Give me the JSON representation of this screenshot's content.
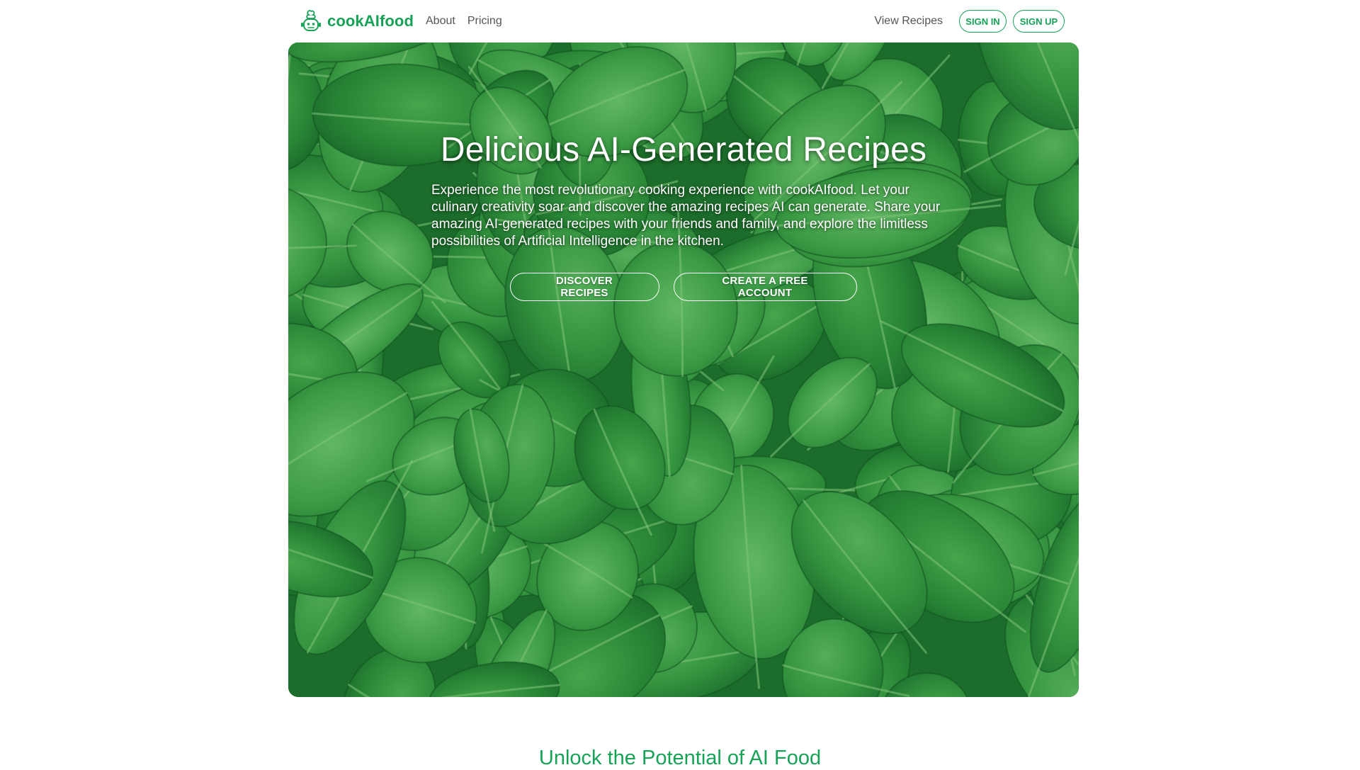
{
  "brand": {
    "name": "cookAIfood",
    "icon": "chef-robot-icon",
    "color": "#17a257"
  },
  "nav": {
    "about": "About",
    "pricing": "Pricing",
    "view_recipes": "View Recipes",
    "sign_in": "SIGN IN",
    "sign_up": "SIGN UP"
  },
  "hero": {
    "title": "Delicious AI-Generated Recipes",
    "description": "Experience the most revolutionary cooking experience with cookAIfood. Let your culinary creativity soar and discover the amazing recipes AI can generate. Share your amazing AI-generated recipes with your friends and family, and explore the limitless possibilities of Artificial Intelligence in the kitchen.",
    "discover_button": "DISCOVER RECIPES",
    "create_button": "CREATE A FREE ACCOUNT",
    "background": "spinach-leaves-image"
  },
  "section": {
    "heading": "Unlock the Potential of AI Food"
  }
}
